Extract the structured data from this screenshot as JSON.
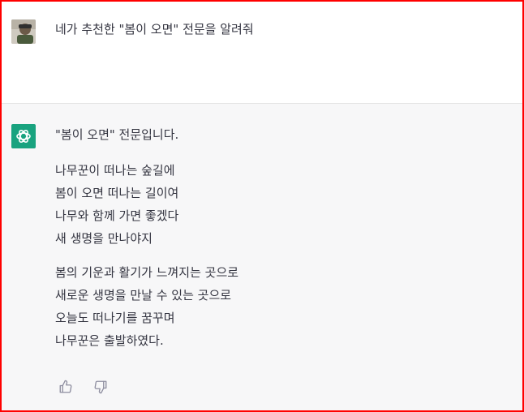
{
  "conversation": {
    "user_message": "네가 추천한 \"봄이 오면\" 전문을 알려줘",
    "assistant": {
      "intro": "\"봄이 오면\" 전문입니다.",
      "stanzas": [
        [
          "나무꾼이 떠나는 숲길에",
          "봄이 오면 떠나는 길이여",
          "나무와 함께 가면 좋겠다",
          "새 생명을 만나야지"
        ],
        [
          "봄의 기운과 활기가 느껴지는 곳으로",
          "새로운 생명을 만날 수 있는 곳으로",
          "오늘도 떠나기를 꿈꾸며",
          "나무꾼은 출발하였다."
        ]
      ]
    }
  },
  "icons": {
    "user_avatar": "user-avatar-photo",
    "assistant_avatar": "openai-logo-icon",
    "thumbs_up": "thumbs-up-icon",
    "thumbs_down": "thumbs-down-icon"
  },
  "colors": {
    "accent": "#19a37f",
    "frame_border": "#ff0000",
    "assistant_bg": "#f7f7f8",
    "text": "#343541"
  }
}
